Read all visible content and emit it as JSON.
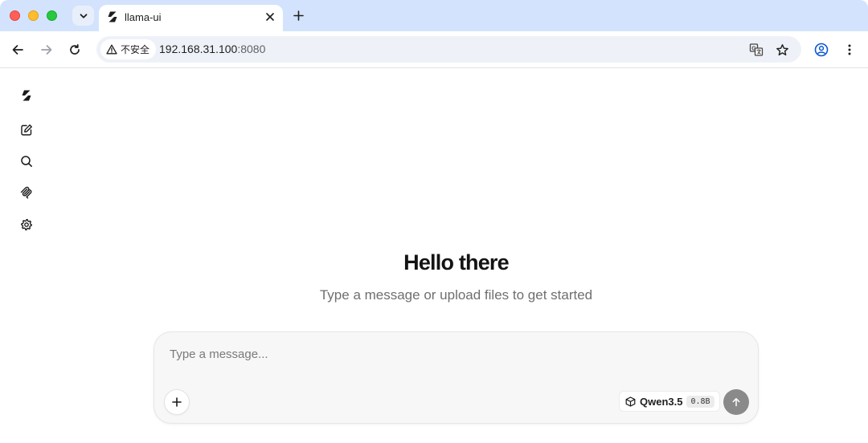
{
  "browser": {
    "tab": {
      "title": "llama-ui",
      "favicon": "llama-logo-icon"
    },
    "address": {
      "security_label": "不安全",
      "host": "192.168.31.100",
      "port": ":8080"
    }
  },
  "sidebar": {
    "items": [
      {
        "icon": "llama-logo-icon"
      },
      {
        "icon": "new-chat-icon"
      },
      {
        "icon": "search-icon"
      },
      {
        "icon": "mcp-icon"
      },
      {
        "icon": "gear-icon"
      }
    ]
  },
  "main": {
    "heading": "Hello there",
    "subtitle": "Type a message or upload files to get started"
  },
  "composer": {
    "placeholder": "Type a message...",
    "model_name": "Qwen3.5",
    "model_size": "0.8B"
  }
}
